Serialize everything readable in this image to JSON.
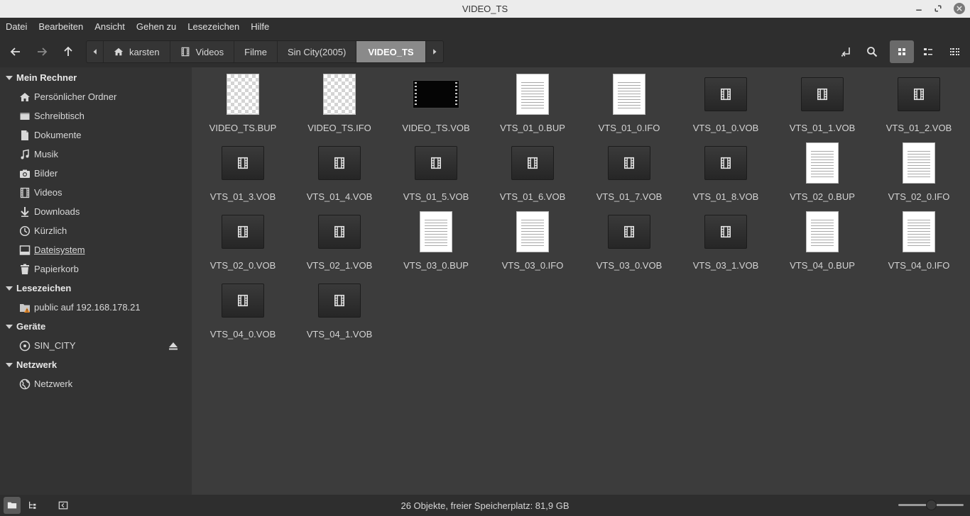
{
  "window": {
    "title": "VIDEO_TS"
  },
  "menu": [
    "Datei",
    "Bearbeiten",
    "Ansicht",
    "Gehen zu",
    "Lesezeichen",
    "Hilfe"
  ],
  "breadcrumb": [
    "karsten",
    "Videos",
    "Filme",
    "Sin City(2005)",
    "VIDEO_TS"
  ],
  "sidebar": {
    "sections": [
      {
        "title": "Mein Rechner",
        "items": [
          {
            "label": "Persönlicher Ordner",
            "icon": "home-icon"
          },
          {
            "label": "Schreibtisch",
            "icon": "desktop-icon"
          },
          {
            "label": "Dokumente",
            "icon": "document-icon"
          },
          {
            "label": "Musik",
            "icon": "music-icon"
          },
          {
            "label": "Bilder",
            "icon": "camera-icon"
          },
          {
            "label": "Videos",
            "icon": "film-icon"
          },
          {
            "label": "Downloads",
            "icon": "download-icon"
          },
          {
            "label": "Kürzlich",
            "icon": "clock-icon"
          },
          {
            "label": "Dateisystem",
            "icon": "drive-icon"
          },
          {
            "label": "Papierkorb",
            "icon": "trash-icon"
          }
        ]
      },
      {
        "title": "Lesezeichen",
        "items": [
          {
            "label": "public auf 192.168.178.21",
            "icon": "network-folder-icon"
          }
        ]
      },
      {
        "title": "Geräte",
        "items": [
          {
            "label": "SIN_CITY",
            "icon": "disc-icon"
          }
        ]
      },
      {
        "title": "Netzwerk",
        "items": [
          {
            "label": "Netzwerk",
            "icon": "globe-icon"
          }
        ]
      }
    ]
  },
  "files": [
    {
      "name": "VIDEO_TS.BUP",
      "type": "unknown"
    },
    {
      "name": "VIDEO_TS.IFO",
      "type": "unknown"
    },
    {
      "name": "VIDEO_TS.VOB",
      "type": "thumbnail"
    },
    {
      "name": "VTS_01_0.BUP",
      "type": "text"
    },
    {
      "name": "VTS_01_0.IFO",
      "type": "text"
    },
    {
      "name": "VTS_01_0.VOB",
      "type": "video"
    },
    {
      "name": "VTS_01_1.VOB",
      "type": "video"
    },
    {
      "name": "VTS_01_2.VOB",
      "type": "video"
    },
    {
      "name": "VTS_01_3.VOB",
      "type": "video"
    },
    {
      "name": "VTS_01_4.VOB",
      "type": "video"
    },
    {
      "name": "VTS_01_5.VOB",
      "type": "video"
    },
    {
      "name": "VTS_01_6.VOB",
      "type": "video"
    },
    {
      "name": "VTS_01_7.VOB",
      "type": "video"
    },
    {
      "name": "VTS_01_8.VOB",
      "type": "video"
    },
    {
      "name": "VTS_02_0.BUP",
      "type": "text"
    },
    {
      "name": "VTS_02_0.IFO",
      "type": "text"
    },
    {
      "name": "VTS_02_0.VOB",
      "type": "video"
    },
    {
      "name": "VTS_02_1.VOB",
      "type": "video"
    },
    {
      "name": "VTS_03_0.BUP",
      "type": "text"
    },
    {
      "name": "VTS_03_0.IFO",
      "type": "text"
    },
    {
      "name": "VTS_03_0.VOB",
      "type": "video"
    },
    {
      "name": "VTS_03_1.VOB",
      "type": "video"
    },
    {
      "name": "VTS_04_0.BUP",
      "type": "text"
    },
    {
      "name": "VTS_04_0.IFO",
      "type": "text"
    },
    {
      "name": "VTS_04_0.VOB",
      "type": "video"
    },
    {
      "name": "VTS_04_1.VOB",
      "type": "video"
    }
  ],
  "status": {
    "text": "26 Objekte, freier Speicherplatz: 81,9 GB",
    "zoom_level": 0.5
  },
  "colors": {
    "background": "#3c3c3c",
    "sidebar": "#333333",
    "toolbar": "#2e2e2e",
    "active_crumb": "#8a8a8a"
  }
}
